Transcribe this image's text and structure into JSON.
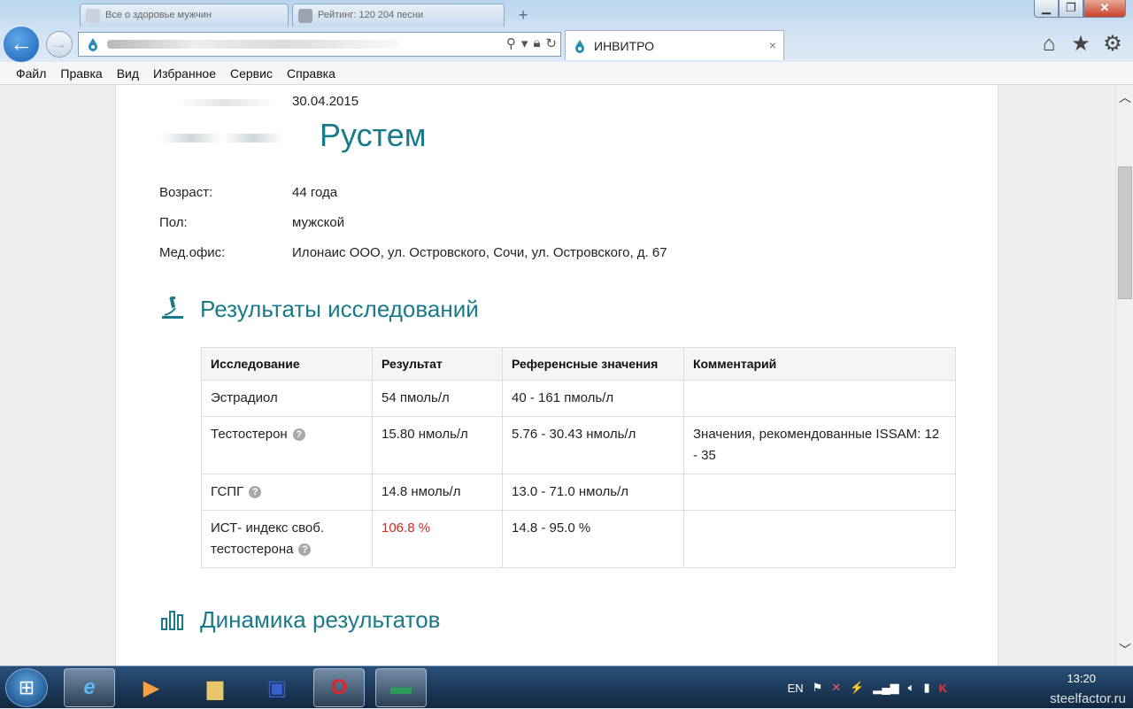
{
  "browser": {
    "tabs": [
      {
        "label": "Все о здоровье мужчин"
      },
      {
        "label": "Рейтинг: 120 204 песни"
      }
    ],
    "address": {
      "url": ""
    },
    "active_tab": {
      "label": "ИНВИТРО",
      "close": "×"
    },
    "window_buttons": {
      "min": "▁",
      "max": "❐",
      "close": "✕"
    },
    "new_tab": "+"
  },
  "menu": [
    "Файл",
    "Правка",
    "Вид",
    "Избранное",
    "Сервис",
    "Справка"
  ],
  "patient": {
    "date": "30.04.2015",
    "name": "Рустем",
    "age_label": "Возраст:",
    "age": "44 года",
    "sex_label": "Пол:",
    "sex": "мужской",
    "office_label": "Мед.офис:",
    "office": "Илонаис ООО, ул. Островского, Сочи, ул. Островского, д. 67"
  },
  "results": {
    "title": "Результаты исследований",
    "headers": [
      "Исследование",
      "Результат",
      "Референсные значения",
      "Комментарий"
    ],
    "rows": [
      {
        "test": "Эстрадиол",
        "result": "54 пмоль/л",
        "ref": "40 - 161 пмоль/л",
        "comment": ""
      },
      {
        "test": "Тестостерон",
        "result": "15.80 нмоль/л",
        "ref": "5.76 - 30.43 нмоль/л",
        "comment": "Значения, рекомендованные ISSAM: 12 - 35"
      },
      {
        "test": "ГСПГ",
        "result": "14.8 нмоль/л",
        "ref": "13.0 - 71.0 нмоль/л",
        "comment": ""
      },
      {
        "test": "ИСТ- индекс своб. тестостерона",
        "result": "106.8 %",
        "ref": "14.8 - 95.0 %",
        "comment": ""
      }
    ],
    "help_glyph": "?",
    "alert_color": "#d9251c"
  },
  "dynamics": {
    "title": "Динамика результатов"
  },
  "accent_color": "#1b7a8a",
  "taskbar": {
    "lang": "EN",
    "time": "13:20",
    "watermark": "steelfactor.ru"
  }
}
